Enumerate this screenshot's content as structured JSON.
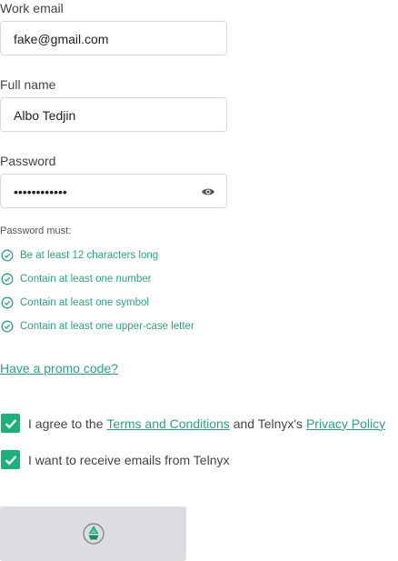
{
  "fields": {
    "email": {
      "label": "Work email",
      "value": "fake@gmail.com"
    },
    "name": {
      "label": "Full name",
      "value": "Albo Tedjin"
    },
    "password": {
      "label": "Password",
      "value": "••••••••••••"
    }
  },
  "password_rules": {
    "title": "Password must:",
    "items": [
      "Be at least 12 characters long",
      "Contain at least one number",
      "Contain at least one symbol",
      "Contain at least one upper-case letter"
    ]
  },
  "promo_link": "Have a promo code?",
  "agreements": {
    "terms": {
      "prefix": "I agree to the ",
      "terms_link": "Terms and Conditions",
      "middle": " and Telnyx's ",
      "privacy_link": "Privacy Policy",
      "checked": true
    },
    "emails": {
      "label": "I want to receive emails from Telnyx",
      "checked": true
    }
  },
  "icons": {
    "password_toggle": "eye-icon",
    "rule_status": "check-circle-icon",
    "checkbox_mark": "checkmark-icon",
    "submit_loading": "telnyx-loading-icon"
  },
  "colors": {
    "accent": "#19b37a",
    "rule_text": "#2aa57a",
    "button_disabled": "#dcdde0"
  }
}
